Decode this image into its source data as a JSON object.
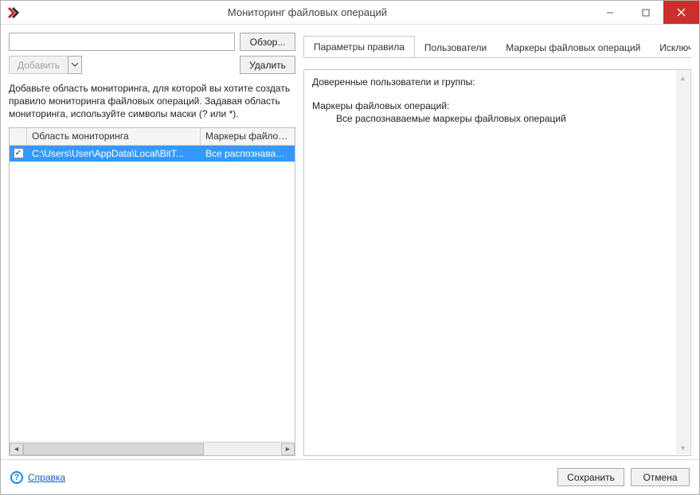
{
  "window": {
    "title": "Мониторинг файловых операций"
  },
  "left": {
    "browse_button": "Обзор...",
    "add_button": "Добавить",
    "delete_button": "Удалить",
    "path_input_value": "",
    "hint": "Добавьте область мониторинга, для которой вы хотите создать правило мониторинга файловых операций. Задавая область мониторинга, используйте символы маски (? или *).",
    "table": {
      "columns": [
        "",
        "Область мониторинга",
        "Маркеры файловых опе"
      ],
      "rows": [
        {
          "checked": true,
          "area": "C:\\Users\\User\\AppData\\Local\\BitT...",
          "markers": "Все распознаваемые мар"
        }
      ]
    }
  },
  "tabs": {
    "items": [
      "Параметры правила",
      "Пользователи",
      "Маркеры файловых операций",
      "Исключени"
    ],
    "active_index": 0
  },
  "detail": {
    "trusted_label": "Доверенные пользователи и группы:",
    "markers_label": "Маркеры файловых операций:",
    "markers_value": "Все распознаваемые маркеры файловых операций"
  },
  "footer": {
    "help": "Справка",
    "save": "Сохранить",
    "cancel": "Отмена"
  }
}
